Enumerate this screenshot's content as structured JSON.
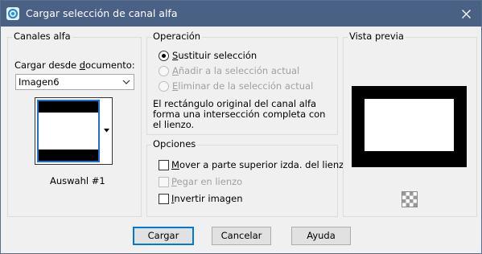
{
  "window": {
    "title": "Cargar selección de canal alfa",
    "colors": {
      "titlebar": "#4a6186",
      "accent": "#0078d7"
    }
  },
  "alpha_channels": {
    "legend": "Canales alfa",
    "load_from_label": "Cargar desde documento:",
    "document_selected": "Imagen6",
    "channel_name": "Auswahl #1"
  },
  "operation": {
    "legend": "Operación",
    "options": [
      {
        "label": "Sustituir selección",
        "selected": true,
        "enabled": true
      },
      {
        "label": "Añadir a la selección actual",
        "selected": false,
        "enabled": false
      },
      {
        "label": "Eliminar de la selección actual",
        "selected": false,
        "enabled": false
      }
    ],
    "description": [
      "El rectángulo original del canal alfa",
      "forma una intersección completa con",
      "el lienzo."
    ]
  },
  "options": {
    "legend": "Opciones",
    "items": [
      {
        "label": "Mover a parte superior izda. del lienzo",
        "checked": false,
        "enabled": true
      },
      {
        "label": "Pegar en lienzo",
        "checked": false,
        "enabled": false
      },
      {
        "label": "Invertir imagen",
        "checked": false,
        "enabled": true
      }
    ]
  },
  "preview": {
    "legend": "Vista previa"
  },
  "buttons": {
    "load": "Cargar",
    "cancel": "Cancelar",
    "help": "Ayuda"
  },
  "icons": {
    "app": "app-icon",
    "close": "close-icon",
    "dropdown": "chevron-down-icon",
    "preview_toggle": "checkerboard-icon"
  }
}
